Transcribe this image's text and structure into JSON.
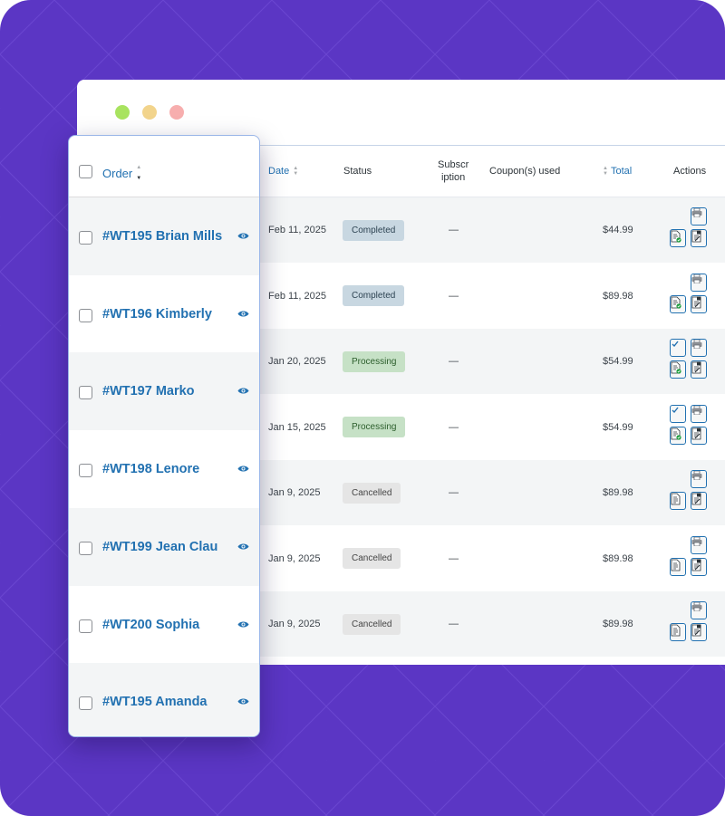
{
  "window": {
    "dot_colors": [
      "#a8e35f",
      "#f2d48c",
      "#f7aeae"
    ]
  },
  "colors": {
    "background": "#5b36c4",
    "link": "#2271b1",
    "completed_bg": "#c8d7e1",
    "processing_bg": "#c6e1c6",
    "cancelled_bg": "#e5e5e5"
  },
  "table": {
    "headers": {
      "date": "Date",
      "status": "Status",
      "subscription_line1": "Subscr",
      "subscription_line2": "iption",
      "coupons": "Coupon(s) used",
      "total": "Total",
      "actions": "Actions"
    },
    "rows": [
      {
        "date": "Feb 11, 2025",
        "status": "Completed",
        "status_key": "completed",
        "coupon": "—",
        "total": "$44.99",
        "actions": [
          "print-icon",
          "invoice-check-icon",
          "packing-slip-icon"
        ]
      },
      {
        "date": "Feb 11, 2025",
        "status": "Completed",
        "status_key": "completed",
        "coupon": "—",
        "total": "$89.98",
        "actions": [
          "print-icon",
          "invoice-check-icon",
          "packing-slip-icon"
        ]
      },
      {
        "date": "Jan 20, 2025",
        "status": "Processing",
        "status_key": "processing",
        "coupon": "—",
        "total": "$54.99",
        "actions": [
          "complete-check-icon",
          "print-icon",
          "invoice-check-icon",
          "packing-slip-icon"
        ]
      },
      {
        "date": "Jan 15, 2025",
        "status": "Processing",
        "status_key": "processing",
        "coupon": "—",
        "total": "$54.99",
        "actions": [
          "complete-check-icon",
          "print-icon",
          "invoice-check-icon",
          "packing-slip-icon"
        ]
      },
      {
        "date": "Jan 9, 2025",
        "status": "Cancelled",
        "status_key": "cancelled",
        "coupon": "—",
        "total": "$89.98",
        "actions": [
          "print-icon",
          "invoice-icon",
          "packing-slip-icon"
        ]
      },
      {
        "date": "Jan 9, 2025",
        "status": "Cancelled",
        "status_key": "cancelled",
        "coupon": "—",
        "total": "$89.98",
        "actions": [
          "print-icon",
          "invoice-icon",
          "packing-slip-icon"
        ]
      },
      {
        "date": "Jan 9, 2025",
        "status": "Cancelled",
        "status_key": "cancelled",
        "coupon": "—",
        "total": "$89.98",
        "actions": [
          "print-icon",
          "invoice-icon",
          "packing-slip-icon"
        ]
      }
    ]
  },
  "panel": {
    "header": "Order",
    "orders": [
      "#WT195 Brian Mills",
      "#WT196 Kimberly",
      "#WT197 Marko",
      "#WT198 Lenore",
      "#WT199 Jean Clau",
      "#WT200 Sophia",
      "#WT195 Amanda"
    ],
    "row_icon": "eye-icon"
  }
}
